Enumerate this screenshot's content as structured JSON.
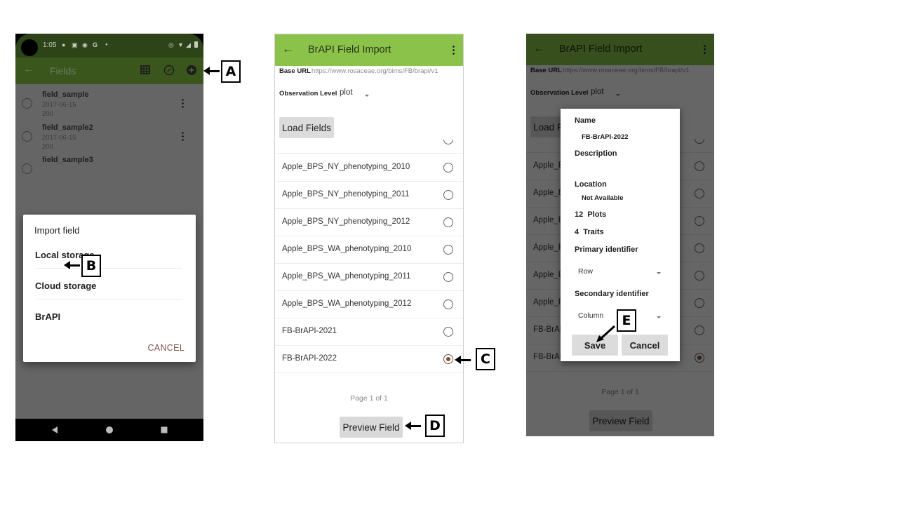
{
  "screen1": {
    "status_bar": {
      "time": "1:05",
      "left_icons": [
        "location-pin-icon",
        "photo-icon",
        "ball-icon",
        "google-icon",
        "dot-icon"
      ],
      "right_icons": [
        "location-icon",
        "wifi-icon",
        "signal-icon",
        "battery-icon"
      ]
    },
    "toolbar": {
      "back_icon": "arrow-left-icon",
      "title": "Fields",
      "actions": [
        "table-add-icon",
        "compass-icon",
        "add-circle-icon"
      ]
    },
    "fields": [
      {
        "name": "field_sample",
        "date": "2017-06-15",
        "count": "200"
      },
      {
        "name": "field_sample2",
        "date": "2017-06-15",
        "count": "200"
      },
      {
        "name": "field_sample3",
        "date": "",
        "count": ""
      }
    ],
    "import_dialog": {
      "title": "Import field",
      "options": [
        "Local storage",
        "Cloud storage",
        "BrAPI"
      ],
      "cancel_label": "CANCEL"
    },
    "nav_bar": [
      "back-triangle-icon",
      "home-circle-icon",
      "recents-square-icon"
    ]
  },
  "screen2": {
    "toolbar": {
      "title": "BrAPI Field Import",
      "back_icon": "arrow-left-icon",
      "menu_icon": "more-vert-icon"
    },
    "base_url_label": "Base URL",
    "base_url_value": "https://www.rosaceae.org/bims/FB/brapi/v1",
    "observation_level_label": "Observation Level",
    "observation_level_value": "plot",
    "load_fields_label": "Load Fields",
    "studies": [
      {
        "name": "Apple_BPS_NY_phenotyping_2010",
        "selected": false
      },
      {
        "name": "Apple_BPS_NY_phenotyping_2011",
        "selected": false
      },
      {
        "name": "Apple_BPS_NY_phenotyping_2012",
        "selected": false
      },
      {
        "name": "Apple_BPS_WA_phenotyping_2010",
        "selected": false
      },
      {
        "name": "Apple_BPS_WA_phenotyping_2011",
        "selected": false
      },
      {
        "name": "Apple_BPS_WA_phenotyping_2012",
        "selected": false
      },
      {
        "name": "FB-BrAPI-2021",
        "selected": false
      },
      {
        "name": "FB-BrAPI-2022",
        "selected": true
      }
    ],
    "page_text": "Page 1 of 1",
    "preview_label": "Preview Field"
  },
  "screen3": {
    "list_truncated": [
      "Apple_B",
      "Apple_B",
      "Apple_B",
      "Apple_B",
      "Apple_B",
      "Apple_B",
      "FB-BrAP",
      "FB-BrAP"
    ],
    "dialog": {
      "name_label": "Name",
      "name_value": "FB-BrAPI-2022",
      "description_label": "Description",
      "description_value": "",
      "location_label": "Location",
      "location_value": "Not Available",
      "plots_count": "12",
      "plots_label": "Plots",
      "traits_count": "4",
      "traits_label": "Traits",
      "primary_label": "Primary identifier",
      "primary_value": "Row",
      "secondary_label": "Secondary identifier",
      "secondary_value": "Column",
      "save_label": "Save",
      "cancel_label": "Cancel"
    }
  },
  "callouts": {
    "a": "A",
    "b": "B",
    "c": "C",
    "d": "D",
    "e": "E"
  },
  "colors": {
    "brapi_toolbar": "#8bc34a",
    "fields_toolbar_dim": "#3a561d",
    "radio_selected": "#7d5040",
    "cancel_text": "#7a5548"
  }
}
